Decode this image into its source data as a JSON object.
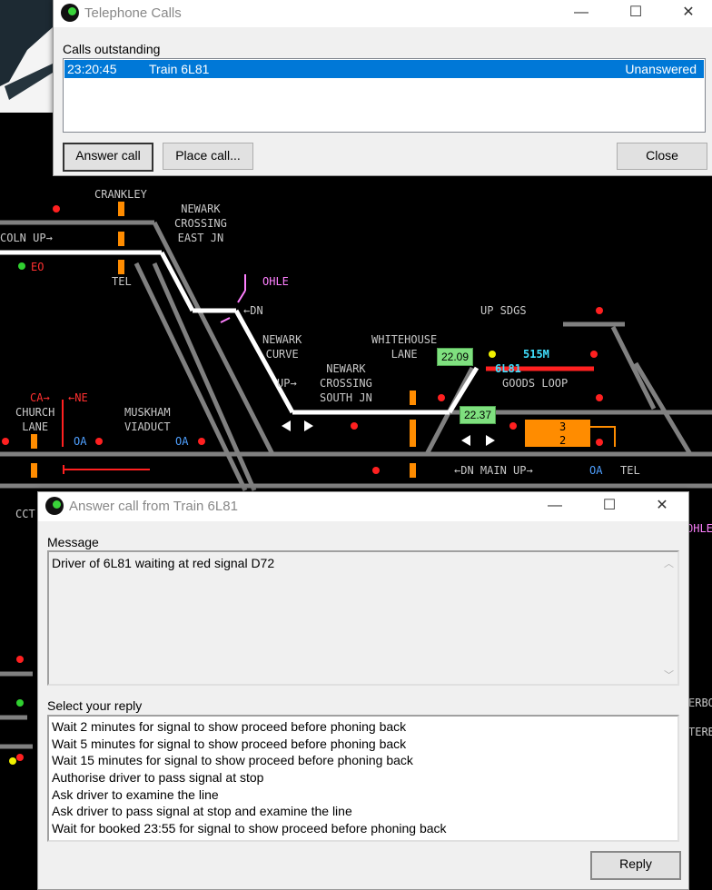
{
  "diagram": {
    "labels": {
      "crankley": "CRANKLEY",
      "newark_east_jn": "NEWARK\nCROSSING\nEAST JN",
      "lincoln_up": "COLN UP→",
      "eo": "EO",
      "tel1": "TEL",
      "ohle": "OHLE",
      "dn": "←DN",
      "newark_curve": "NEWARK\nCURVE",
      "up": "UP→",
      "newark_south_jn": "NEWARK\nCROSSING\nSOUTH JN",
      "whitehouse_lane": "WHITEHOUSE\nLANE",
      "up_sdgs": "UP SDGS",
      "train_515m": "515M",
      "train_6l81": "6L81",
      "goods_loop": "GOODS LOOP",
      "ca": "CA→",
      "ne": "←NE",
      "church_lane": "CHURCH\nLANE",
      "muskham_viaduct": "MUSKHAM\nVIADUCT",
      "oa": "OA",
      "dn_main_up": "←DN MAIN UP→",
      "tel2": "TEL",
      "cct": "CCT",
      "ohle2": "OHLE",
      "erbo": "ERBO",
      "terb": "TERB",
      "loop_count_top": "3",
      "loop_count_bottom": "2"
    },
    "berths": {
      "b1": "22.09",
      "b2": "22.37"
    },
    "colors": {
      "track": "#808080",
      "route": "#ffffff",
      "occupied": "#ff2020",
      "platform": "#ff8c00",
      "berth": "#7fe07f",
      "ohle": "#ff80ff",
      "train_id": "#40e0ff"
    }
  },
  "phone_window": {
    "title": "Telephone Calls",
    "section_label": "Calls outstanding",
    "calls": [
      {
        "time": "23:20:45",
        "train": "Train 6L81",
        "status": "Unanswered"
      }
    ],
    "answer_label": "Answer call",
    "place_label": "Place call...",
    "close_label": "Close",
    "minimize": "—",
    "maximize": "☐",
    "close_x": "✕"
  },
  "answer_window": {
    "title": "Answer call from Train 6L81",
    "message_label": "Message",
    "message": "Driver of 6L81 waiting at red signal D72",
    "reply_label": "Select your reply",
    "replies": [
      "Wait 2 minutes for signal to show proceed before phoning back",
      "Wait 5 minutes for signal to show proceed before phoning back",
      "Wait 15 minutes for signal to show proceed before phoning back",
      "Authorise driver to pass signal at stop",
      "Ask driver to examine the line",
      "Ask driver to pass signal at stop and examine the line",
      "Wait for booked 23:55 for signal to show proceed before phoning back"
    ],
    "reply_button": "Reply",
    "minimize": "—",
    "maximize": "☐",
    "close_x": "✕"
  }
}
